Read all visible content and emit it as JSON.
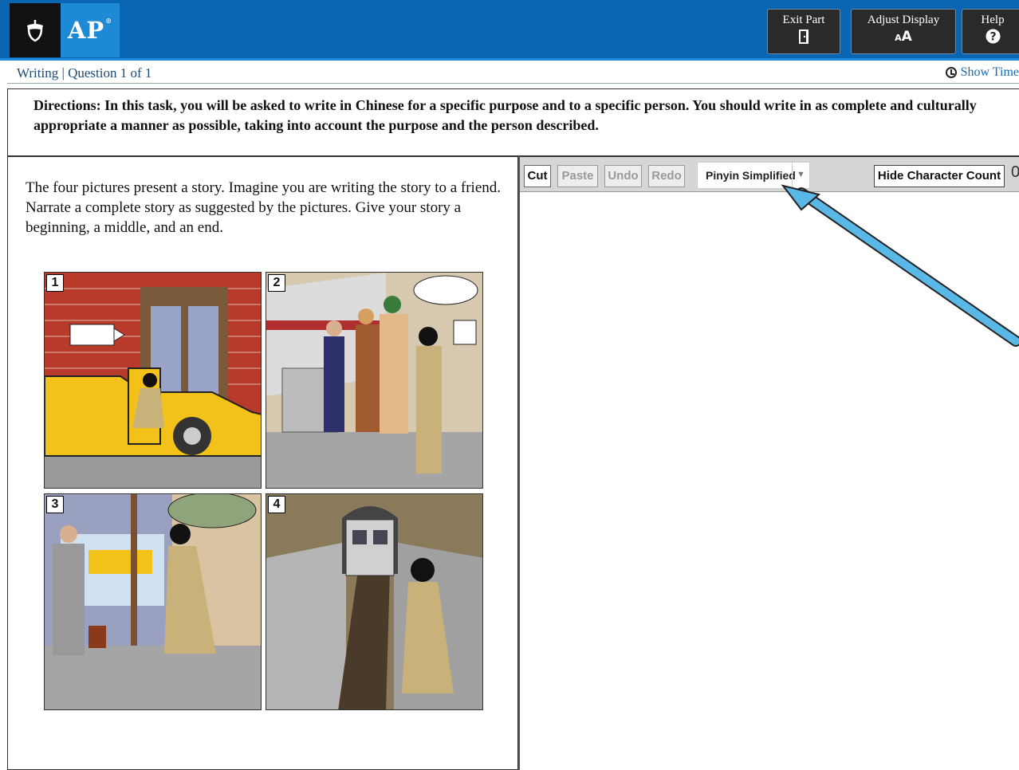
{
  "header": {
    "brand": "AP",
    "buttons": [
      {
        "label": "Exit Part",
        "icon": "door-icon"
      },
      {
        "label": "Adjust Display",
        "icon_text": "AA"
      },
      {
        "label": "Help",
        "icon_text": "?"
      }
    ]
  },
  "subbar": {
    "breadcrumb": "Writing | Question 1 of 1",
    "show_time": "Show Time"
  },
  "directions": "Directions: In this task, you will be asked to write in Chinese for a specific purpose and to a specific person. You should write in as complete and culturally appropriate a manner as possible, taking into account the purpose and the person described.",
  "prompt": "The four pictures present a story.  Imagine you are writing the story to a friend.  Narrate a complete story as suggested by the pictures.  Give your story a beginning, a middle, and an end.",
  "panels": [
    "1",
    "2",
    "3",
    "4"
  ],
  "toolbar": {
    "cut": "Cut",
    "paste": "Paste",
    "undo": "Undo",
    "redo": "Redo",
    "input_method": "Pinyin Simplified",
    "hide_count": "Hide Character Count",
    "count": "0"
  },
  "colors": {
    "header_bg": "#0a66b2",
    "ap_box": "#1e8ad6",
    "arrow": "#5ab8e6"
  }
}
